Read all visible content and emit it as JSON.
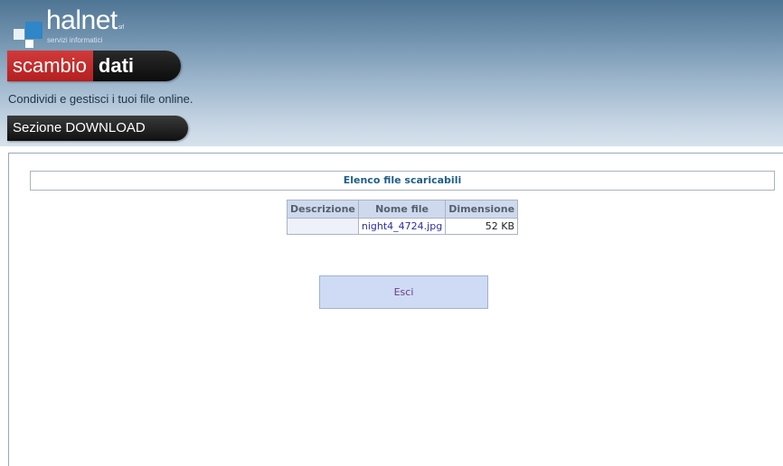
{
  "header": {
    "logo_text": "halnet",
    "logo_suffix": "srl",
    "logo_subtitle": "servizi informatici",
    "app_name_part1": "scambio",
    "app_name_part2": "dati",
    "tagline": "Condividi e gestisci i tuoi file online.",
    "section_label": "Sezione DOWNLOAD"
  },
  "main": {
    "list_title": "Elenco file scaricabili",
    "table": {
      "columns": [
        "Descrizione",
        "Nome file",
        "Dimensione"
      ],
      "rows": [
        {
          "description": "",
          "filename": "night4_4724.jpg",
          "size": "52 KB"
        }
      ]
    },
    "exit_label": "Esci"
  },
  "colors": {
    "header_gradient_top": "#4f7594",
    "header_gradient_bottom": "#d6e1ec",
    "brand_red": "#c22b2b",
    "title_text": "#1f5e86",
    "table_header_bg": "#cfd9ee",
    "link_text": "#2a2fa6",
    "button_bg": "#cfdbf4"
  },
  "icons": {
    "logo": "halnet-logo-squares-icon"
  }
}
